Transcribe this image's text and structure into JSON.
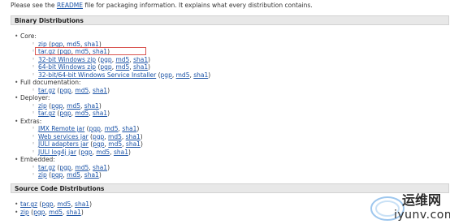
{
  "intro": {
    "before": "Please see the ",
    "link": "README",
    "after": " file for packaging information. It explains what every distribution contains."
  },
  "binary": {
    "title": "Binary Distributions",
    "core": {
      "label": "Core:",
      "items": [
        {
          "main": "zip",
          "sigs": [
            "pgp",
            "md5",
            "sha1"
          ]
        },
        {
          "main": "tar.gz",
          "sigs": [
            "pgp",
            "md5",
            "sha1"
          ]
        },
        {
          "main": "32-bit Windows zip",
          "sigs": [
            "pgp",
            "md5",
            "sha1"
          ]
        },
        {
          "main": "64-bit Windows zip",
          "sigs": [
            "pgp",
            "md5",
            "sha1"
          ]
        },
        {
          "main": "32-bit/64-bit Windows Service Installer",
          "sigs": [
            "pgp",
            "md5",
            "sha1"
          ]
        }
      ]
    },
    "fulldoc": {
      "label": "Full documentation:",
      "items": [
        {
          "main": "tar.gz",
          "sigs": [
            "pgp",
            "md5",
            "sha1"
          ]
        }
      ]
    },
    "deployer": {
      "label": "Deployer:",
      "items": [
        {
          "main": "zip",
          "sigs": [
            "pgp",
            "md5",
            "sha1"
          ]
        },
        {
          "main": "tar.gz",
          "sigs": [
            "pgp",
            "md5",
            "sha1"
          ]
        }
      ]
    },
    "extras": {
      "label": "Extras:",
      "items": [
        {
          "main": "JMX Remote jar",
          "sigs": [
            "pgp",
            "md5",
            "sha1"
          ]
        },
        {
          "main": "Web services jar",
          "sigs": [
            "pgp",
            "md5",
            "sha1"
          ]
        },
        {
          "main": "JULI adapters jar",
          "sigs": [
            "pgp",
            "md5",
            "sha1"
          ]
        },
        {
          "main": "JULI log4j jar",
          "sigs": [
            "pgp",
            "md5",
            "sha1"
          ]
        }
      ]
    },
    "embedded": {
      "label": "Embedded:",
      "items": [
        {
          "main": "tar.gz",
          "sigs": [
            "pgp",
            "md5",
            "sha1"
          ]
        },
        {
          "main": "zip",
          "sigs": [
            "pgp",
            "md5",
            "sha1"
          ]
        }
      ]
    }
  },
  "source": {
    "title": "Source Code Distributions",
    "items": [
      {
        "main": "tar.gz",
        "sigs": [
          "pgp",
          "md5",
          "sha1"
        ]
      },
      {
        "main": "zip",
        "sigs": [
          "pgp",
          "md5",
          "sha1"
        ]
      }
    ]
  },
  "watermark": {
    "cn": "运维网",
    "url": "iyunv.com"
  }
}
